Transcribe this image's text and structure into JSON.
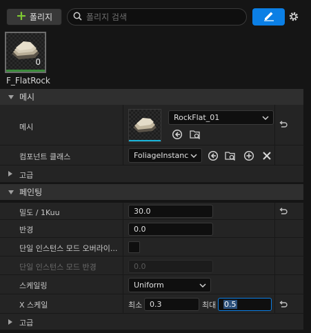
{
  "toolbar": {
    "add_label": "폴리지",
    "search_placeholder": "폴리지 검색"
  },
  "tile": {
    "label": "F_FlatRock",
    "count": "0"
  },
  "mesh_section": {
    "title": "메시",
    "mesh_label": "메시",
    "mesh_asset": "RockFlat_01",
    "component_class_label": "컴포넌트 클래스",
    "component_class_value": "FoliageInstanc"
  },
  "advanced_1": {
    "title": "고급"
  },
  "painting_section": {
    "title": "페인팅",
    "density_label": "밀도 / 1Kuu",
    "density_value": "30.0",
    "radius_label": "반경",
    "radius_value": "0.0",
    "single_instance_override_label": "단일 인스턴스 모드 오버라이...",
    "single_instance_radius_label": "단일 인스턴스 모드 반경",
    "single_instance_radius_value": "0.0",
    "scaling_label": "스케일링",
    "scaling_value": "Uniform",
    "x_scale_label": "X 스케일",
    "min_label": "최소",
    "min_value": "0.3",
    "max_label": "최대",
    "max_value": "0.5"
  },
  "advanced_2": {
    "title": "고급"
  },
  "colors": {
    "accent": "#0b7fe5",
    "add_plus": "#7ec832",
    "panel": "#242424",
    "category": "#2f2f2f"
  }
}
